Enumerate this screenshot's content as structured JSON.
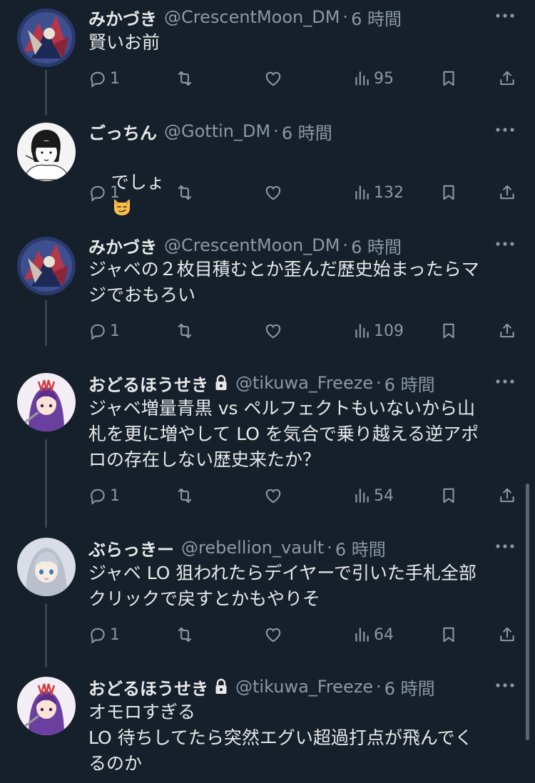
{
  "tweets": [
    {
      "name": "みかづき",
      "handle": "@CrescentMoon_DM",
      "dot": "·",
      "time": "6 時間",
      "locked": false,
      "text": "賢いお前",
      "replies": "1",
      "views": "95",
      "avatar": "dragon-art"
    },
    {
      "name": "ごっちん",
      "handle": "@Gottin_DM",
      "dot": "·",
      "time": "6 時間",
      "locked": false,
      "text": "でしょ",
      "emoji": "smirking-cat-emoji",
      "replies": "1",
      "views": "132",
      "avatar": "manga-girl"
    },
    {
      "name": "みかづき",
      "handle": "@CrescentMoon_DM",
      "dot": "·",
      "time": "6 時間",
      "locked": false,
      "text": "ジャベの２枚目積むとか歪んだ歴史始まったらマ\nジでおもろい",
      "replies": "1",
      "views": "109",
      "avatar": "dragon-art"
    },
    {
      "name": "おどるほうせき",
      "handle": "@tikuwa_Freeze",
      "dot": "·",
      "time": "6 時間",
      "locked": true,
      "text": "ジャベ増量青黒 vs ペルフェクトもいないから山\n札を更に増やして LO を気合で乗り越える逆アポ\nロの存在しない歴史来たか？",
      "replies": "1",
      "views": "54",
      "avatar": "purple-hair-character"
    },
    {
      "name": "ぶらっきー",
      "handle": "@rebellion_vault",
      "dot": "·",
      "time": "6 時間",
      "locked": false,
      "text": "ジャベ LO 狙われたらデイヤーで引いた手札全部\nクリックで戻すとかもやりそ",
      "replies": "1",
      "views": "64",
      "avatar": "silver-hair-character"
    },
    {
      "name": "おどるほうせき",
      "handle": "@tikuwa_Freeze",
      "dot": "·",
      "time": "6 時間",
      "locked": true,
      "text": "オモロすぎる\nLO 待ちしてたら突然エグい超過打点が飛んでく\nるのか",
      "replies": "",
      "views": "",
      "avatar": "purple-hair-character"
    }
  ],
  "colors": {
    "background": "#15202b",
    "text": "#e7e9ea",
    "secondary": "#8b98a5",
    "thread_line": "#38444d"
  },
  "icons": [
    "reply-icon",
    "retweet-icon",
    "like-icon",
    "views-icon",
    "bookmark-icon",
    "share-icon",
    "more-icon",
    "lock-icon"
  ]
}
